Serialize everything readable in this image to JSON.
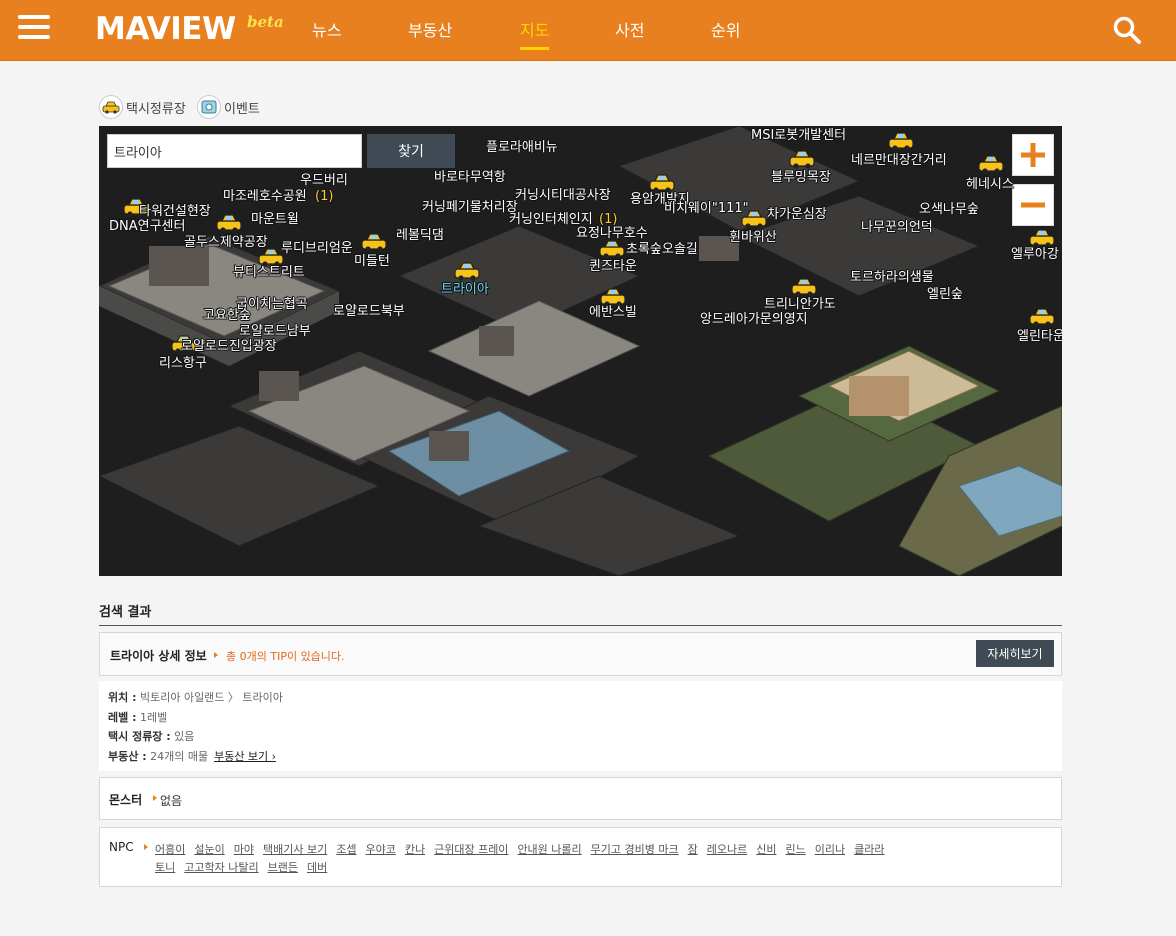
{
  "header": {
    "logo": "MAVIEW",
    "logo_badge": "beta",
    "nav": [
      "뉴스",
      "부동산",
      "지도",
      "사전",
      "순위"
    ],
    "active_nav": "지도",
    "brand_color": "#e8801f",
    "active_color": "#ffd200"
  },
  "legend": {
    "taxi_label": "택시정류장",
    "event_label": "이벤트"
  },
  "map": {
    "search_value": "트라이아",
    "find_label": "찾기",
    "zoom_in_icon": "plus-icon",
    "zoom_out_icon": "minus-icon",
    "places": [
      "MSI로봇개발센터",
      "플로라애비뉴",
      "네르만대장간거리",
      "블루밍목장",
      "헤네시스",
      "우드버리",
      "바로타무역항",
      "커닝시티대공사장",
      "용암개발지",
      "마조레호수공원",
      "(1)",
      "커닝페기물처리장",
      "커닝인터체인지",
      "(1)",
      "비치웨이\"111\"",
      "차가운심장",
      "오색나무숲",
      "타워건설현장",
      "DNA연구센터",
      "마운트윌",
      "레볼딕댐",
      "요정나무호수",
      "휜바위산",
      "나무꾼의언덕",
      "골두스제약공장",
      "루디브리엄운",
      "미들턴",
      "초록숲오솔길",
      "엘루아강",
      "퀸즈타운",
      "뷰티스트리트",
      "트라이아",
      "토르하라의샘물",
      "엘린숲",
      "굽이치는협곡",
      "로얄로드북부",
      "트리니안가도",
      "고요한숲",
      "에반스빌",
      "앙드레아가문의영지",
      "엘린타운",
      "로얄로드남부",
      "로얄로드진입광장",
      "리스항구"
    ]
  },
  "results": {
    "title": "검색 결과",
    "detail_title": "트라이아 상세 정보",
    "tip_text": "총 0개의 TIP이 있습니다.",
    "detail_button": "자세히보기",
    "location_label": "위치 :",
    "location_value": "빅토리아 아일랜드 〉 트라이아",
    "level_label": "레벨 :",
    "level_value": "1레벨",
    "taxi_label": "택시 정류장 :",
    "taxi_value": "있음",
    "realestate_label": "부동산 :",
    "realestate_value": "24개의 매물",
    "realestate_link": "부동산 보기 ›",
    "monster_label": "몬스터",
    "monster_value": "없음",
    "npc_label": "NPC",
    "npcs": [
      "어흥이",
      "설눈이",
      "마야",
      "택배기사 보기",
      "조셉",
      "우야코",
      "칸나",
      "근위대장 프레이",
      "안내원 나롤리",
      "무기고 경비병 마크",
      "잠",
      "레오나르",
      "신비",
      "린느",
      "이리나",
      "클라라",
      "토니",
      "고고학자 나탈리",
      "브랜든",
      "데버"
    ]
  }
}
